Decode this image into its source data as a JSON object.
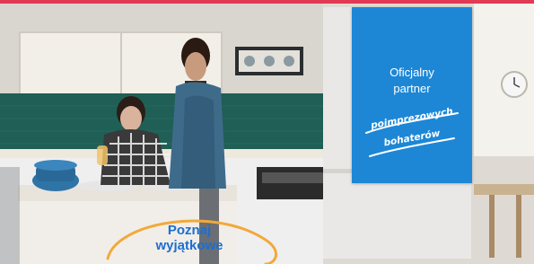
{
  "brand": {
    "accent": "#e03a54",
    "promo_blue": "#1d87d6",
    "cta_blue": "#1c6fd0",
    "highlight_orange": "#f2a93a"
  },
  "promo": {
    "line1": "Oficjalny",
    "line2": "partner",
    "highlight_line1": "poimprezowych",
    "highlight_line2": "bohaterów"
  },
  "cta": {
    "line1": "Poznaj",
    "line2": "wyjątkowe"
  },
  "illustration": {
    "wall_art_icons": [
      "leaf-icon",
      "leaf-icon",
      "leaf-icon"
    ]
  }
}
